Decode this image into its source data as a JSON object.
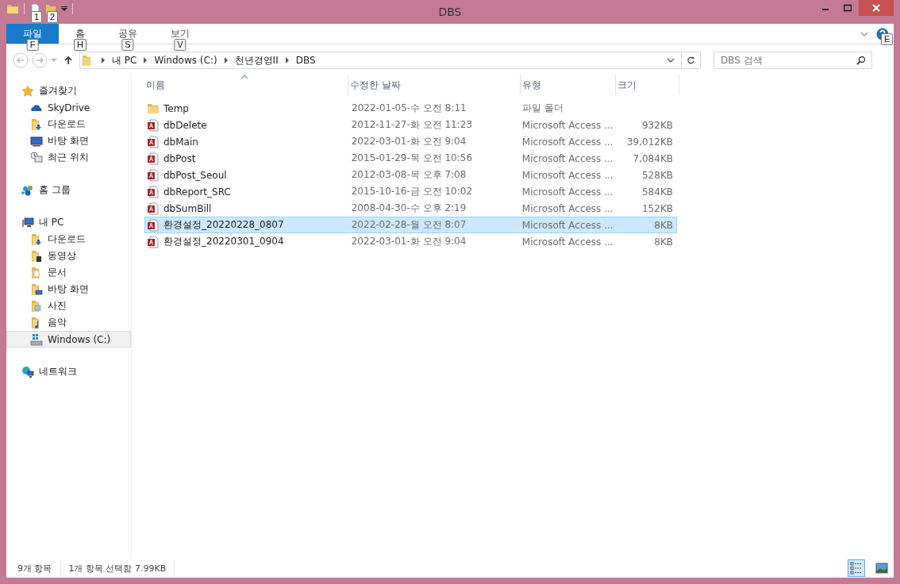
{
  "window": {
    "title": "DBS"
  },
  "quick_access": [
    {
      "kind": "properties",
      "keytip": "1"
    },
    {
      "kind": "new-folder",
      "keytip": "2"
    }
  ],
  "ribbon": {
    "tabs": [
      {
        "label": "파일",
        "keytip": "F",
        "selected": true
      },
      {
        "label": "홈",
        "keytip": "H",
        "selected": false
      },
      {
        "label": "공유",
        "keytip": "S",
        "selected": false
      },
      {
        "label": "보기",
        "keytip": "V",
        "selected": false
      }
    ],
    "help_keytip": "E"
  },
  "address": {
    "path": [
      "내 PC",
      "Windows (C:)",
      "천년경영II",
      "DBS"
    ]
  },
  "search": {
    "placeholder": "DBS 검색"
  },
  "sidebar": {
    "groups": [
      {
        "label": "즐겨찾기",
        "kind": "star",
        "selected": false,
        "children": [
          {
            "label": "SkyDrive",
            "kind": "cloud",
            "selected": false
          },
          {
            "label": "다운로드",
            "kind": "download",
            "selected": false
          },
          {
            "label": "바탕 화면",
            "kind": "desktop",
            "selected": false
          },
          {
            "label": "최근 위치",
            "kind": "recent",
            "selected": false
          }
        ]
      },
      {
        "label": "홈 그룹",
        "kind": "homegroup",
        "selected": false
      },
      {
        "label": "내 PC",
        "kind": "pc",
        "selected": false,
        "children": [
          {
            "label": "다운로드",
            "kind": "download",
            "selected": false
          },
          {
            "label": "동영상",
            "kind": "video",
            "selected": false
          },
          {
            "label": "문서",
            "kind": "document",
            "selected": false
          },
          {
            "label": "바탕 화면",
            "kind": "desktop-folder",
            "selected": false
          },
          {
            "label": "사진",
            "kind": "picture",
            "selected": false
          },
          {
            "label": "음악",
            "kind": "music",
            "selected": false
          },
          {
            "label": "Windows (C:)",
            "kind": "drive",
            "selected": true
          }
        ]
      },
      {
        "label": "네트워크",
        "kind": "network",
        "selected": false
      }
    ]
  },
  "table": {
    "columns": [
      "이름",
      "수정한 날짜",
      "유형",
      "크기"
    ],
    "rows": [
      {
        "kind": "folder",
        "name": "Temp",
        "date": "2022-01-05-수 오전 8:11",
        "type": "파일 폴더",
        "selected": false
      },
      {
        "kind": "access",
        "name": "dbDelete",
        "date": "2012-11-27-화 오전 11:23",
        "type": "Microsoft Access ...",
        "size": "932KB",
        "selected": false
      },
      {
        "kind": "access",
        "name": "dbMain",
        "date": "2022-03-01-화 오전 9:04",
        "type": "Microsoft Access ...",
        "size": "39,012KB",
        "selected": false
      },
      {
        "kind": "access",
        "name": "dbPost",
        "date": "2015-01-29-목 오전 10:56",
        "type": "Microsoft Access ...",
        "size": "7,084KB",
        "selected": false
      },
      {
        "kind": "access",
        "name": "dbPost_Seoul",
        "date": "2012-03-08-목 오후 7:08",
        "type": "Microsoft Access ...",
        "size": "528KB",
        "selected": false
      },
      {
        "kind": "access",
        "name": "dbReport_SRC",
        "date": "2015-10-16-금 오전 10:02",
        "type": "Microsoft Access ...",
        "size": "584KB",
        "selected": false
      },
      {
        "kind": "access",
        "name": "dbSumBill",
        "date": "2008-04-30-수 오후 2:19",
        "type": "Microsoft Access ...",
        "size": "152KB",
        "selected": false
      },
      {
        "kind": "access",
        "name": "환경설정_20220228_0807",
        "date": "2022-02-28-월 오전 8:07",
        "type": "Microsoft Access ...",
        "size": "8KB",
        "selected": true
      },
      {
        "kind": "access",
        "name": "환경설정_20220301_0904",
        "date": "2022-03-01-화 오전 9:04",
        "type": "Microsoft Access ...",
        "size": "8KB",
        "selected": false
      }
    ]
  },
  "status_bar": {
    "item_count": "9개 항목",
    "selection": "1개 항목 선택함 7.99KB"
  },
  "view_buttons": [
    {
      "kind": "details",
      "selected": true
    },
    {
      "kind": "thumbnails",
      "selected": false
    }
  ]
}
